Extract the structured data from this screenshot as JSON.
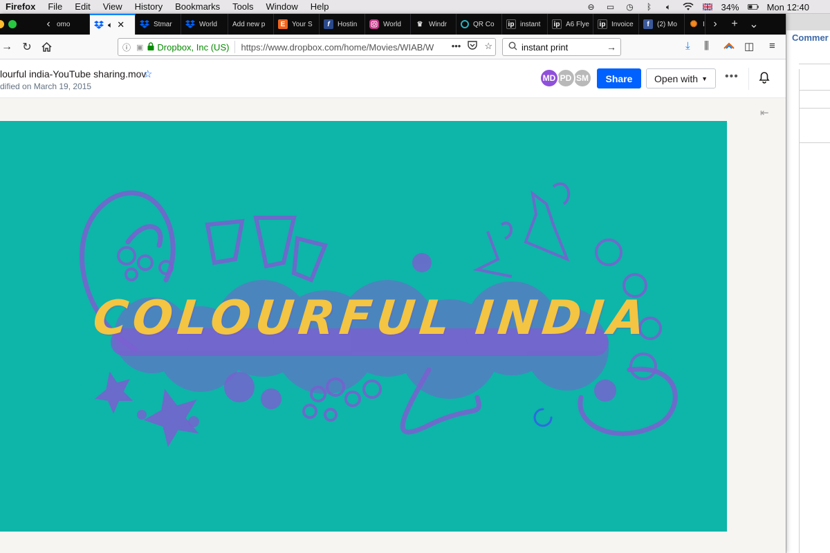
{
  "menubar": {
    "app": "Firefox",
    "items": [
      "File",
      "Edit",
      "View",
      "History",
      "Bookmarks",
      "Tools",
      "Window",
      "Help"
    ],
    "battery": "34%",
    "clock": "Mon 12:40"
  },
  "tabs": [
    {
      "label": "omo",
      "icon": "page-icon",
      "color": "#888888"
    },
    {
      "label": "",
      "icon": "dropbox-icon",
      "color": "#0061fe",
      "active": true
    },
    {
      "label": "Stmar",
      "icon": "dropbox-icon",
      "color": "#0061fe"
    },
    {
      "label": "World",
      "icon": "dropbox-icon",
      "color": "#0061fe"
    },
    {
      "label": "Add new p",
      "icon": "",
      "color": ""
    },
    {
      "label": "Your S",
      "icon": "etsy-icon",
      "color": "#f1641e"
    },
    {
      "label": "Hostin",
      "icon": "f-icon",
      "color": "#2b4a8b"
    },
    {
      "label": "World",
      "icon": "instagram-icon",
      "color": "#c13584"
    },
    {
      "label": "Windr",
      "icon": "crown-icon",
      "color": "#dddddd"
    },
    {
      "label": "QR Co",
      "icon": "qr-icon",
      "color": "#2bb3c0"
    },
    {
      "label": "instant",
      "icon": "ip-icon",
      "color": "#111111"
    },
    {
      "label": "A6 Flye",
      "icon": "ip-icon",
      "color": "#111111"
    },
    {
      "label": "Invoice",
      "icon": "ip-icon",
      "color": "#111111"
    },
    {
      "label": "(2) Mo",
      "icon": "facebook-icon",
      "color": "#3b5998"
    },
    {
      "label": "I",
      "icon": "gear-icon",
      "color": "#f6891f"
    }
  ],
  "navbar": {
    "identity": "Dropbox, Inc (US)",
    "url": "https://www.dropbox.com/home/Movies/WIAB/W",
    "search_value": "instant print"
  },
  "file": {
    "name": "lourful india-YouTube sharing.mov",
    "modified": "dified on March 19, 2015"
  },
  "avatars": [
    {
      "initials": "MD",
      "color": "#8f50db"
    },
    {
      "initials": "PD",
      "color": "#b9b9b9"
    },
    {
      "initials": "SM",
      "color": "#b9b9b9"
    }
  ],
  "actions": {
    "share": "Share",
    "open_with": "Open with"
  },
  "video": {
    "title": "COLOURFUL INDIA",
    "background": "#0eb5a9",
    "accent": "#f3c542",
    "art_color": "#7b5fd0"
  },
  "background_window": {
    "title": "Commer"
  }
}
